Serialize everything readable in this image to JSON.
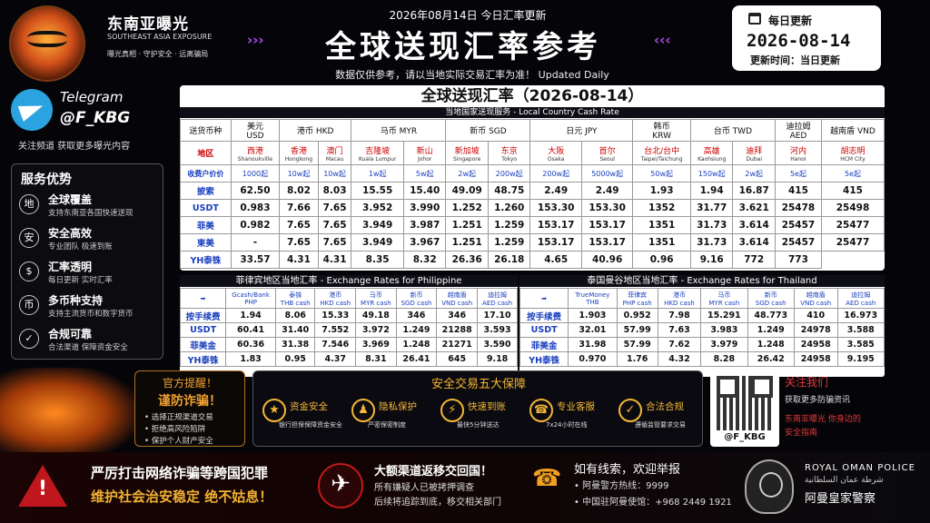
{
  "brand": {
    "name": "东南亚曝光",
    "en": "SOUTHEAST ASIA EXPOSURE",
    "slogan": "曝光真相 · 守护安全 · 远离骗局"
  },
  "header": {
    "top_date": "2026年08月14日  今日汇率更新",
    "title": "全球送现汇率参考",
    "subtitle": "数据仅供参考，请以当地实际交易汇率为准！ Updated Daily"
  },
  "date_box": {
    "heading": "每日更新",
    "date": "2026-08-14",
    "update_time": "更新时间：当日更新"
  },
  "telegram": {
    "label": "Telegram",
    "handle": "@F_KBG",
    "follow": "关注频道  获取更多曝光内容"
  },
  "services": {
    "heading": "服务优势",
    "items": [
      {
        "icon": "地",
        "title": "全球覆盖",
        "desc": "支持东南亚各国快速送现"
      },
      {
        "icon": "安",
        "title": "安全高效",
        "desc": "专业团队  极速到账"
      },
      {
        "icon": "$",
        "title": "汇率透明",
        "desc": "每日更新  实时汇率"
      },
      {
        "icon": "币",
        "title": "多币种支持",
        "desc": "支持主流货币和数字货币"
      },
      {
        "icon": "✓",
        "title": "合规可靠",
        "desc": "合法渠道  保障资金安全"
      }
    ]
  },
  "main_table": {
    "title": "全球送现汇率（2026-08-14）",
    "subtitle": "当地国家送现服务 - Local Country Cash Rate",
    "corner": "送货币种",
    "currencies": [
      {
        "label": "美元\nUSD",
        "span": 1
      },
      {
        "label": "港币  HKD",
        "span": 2
      },
      {
        "label": "马币  MYR",
        "span": 2
      },
      {
        "label": "新币  SGD",
        "span": 2
      },
      {
        "label": "日元  JPY",
        "span": 2
      },
      {
        "label": "韩币\nKRW",
        "span": 1
      },
      {
        "label": "台币  TWD",
        "span": 2
      },
      {
        "label": "迪拉姆\nAED",
        "span": 1
      },
      {
        "label": "越南盾  VND",
        "span": 2
      }
    ],
    "region_label": "地区",
    "locations": [
      {
        "cn": "西港",
        "en": "Shanoukville"
      },
      {
        "cn": "香港",
        "en": "Hongkong"
      },
      {
        "cn": "澳门",
        "en": "Macau"
      },
      {
        "cn": "吉隆坡",
        "en": "Kuala Lumpur"
      },
      {
        "cn": "新山",
        "en": "Johor"
      },
      {
        "cn": "新加坡",
        "en": "Singapore"
      },
      {
        "cn": "东京",
        "en": "Tokyo"
      },
      {
        "cn": "大阪",
        "en": "Osaka"
      },
      {
        "cn": "首尔",
        "en": "Seoul"
      },
      {
        "cn": "台北/台中",
        "en": "Taipei/Taichung"
      },
      {
        "cn": "高雄",
        "en": "Kaohsiung"
      },
      {
        "cn": "迪拜",
        "en": "Dubai"
      },
      {
        "cn": "河内",
        "en": "Hanoi"
      },
      {
        "cn": "胡志明",
        "en": "HCM City"
      }
    ],
    "fee_label": "收费户价价",
    "fees": [
      "1000起",
      "10w起",
      "10w起",
      "1w起",
      "5w起",
      "2w起",
      "200w起",
      "200w起",
      "5000w起",
      "50w起",
      "150w起",
      "2w起",
      "5e起",
      "5e起"
    ],
    "rows": [
      {
        "label": "披索",
        "values": [
          "62.50",
          "8.02",
          "8.03",
          "15.55",
          "15.40",
          "49.09",
          "48.75",
          "2.49",
          "2.49",
          "1.93",
          "1.94",
          "16.87",
          "415",
          "415"
        ]
      },
      {
        "label": "USDT",
        "values": [
          "0.983",
          "7.66",
          "7.65",
          "3.952",
          "3.990",
          "1.252",
          "1.260",
          "153.30",
          "153.30",
          "1352",
          "31.77",
          "3.621",
          "25478",
          "25498"
        ]
      },
      {
        "label": "菲美",
        "values": [
          "0.982",
          "7.65",
          "7.65",
          "3.949",
          "3.987",
          "1.251",
          "1.259",
          "153.17",
          "153.17",
          "1351",
          "31.73",
          "3.614",
          "25457",
          "25477"
        ]
      },
      {
        "label": "柬美",
        "values": [
          "-",
          "7.65",
          "7.65",
          "3.949",
          "3.967",
          "1.251",
          "1.259",
          "153.17",
          "153.17",
          "1351",
          "31.73",
          "3.614",
          "25457",
          "25477"
        ]
      },
      {
        "label": "YH泰铢",
        "values": [
          "33.57",
          "4.31",
          "4.31",
          "8.35",
          "8.32",
          "26.36",
          "26.18",
          "4.65",
          "40.96",
          "0.96",
          "9.16",
          "772",
          "773"
        ]
      }
    ]
  },
  "philippine": {
    "title": "菲律宾地区当地汇率 - Exchange Rates for Philippine",
    "corner": "➡",
    "headers": [
      "Gcash/Bank\nPHP",
      "泰铢\nTHB cash",
      "港币\nHKD cash",
      "马币\nMYR cash",
      "新币\nSGD cash",
      "越南盾\nVND cash",
      "迪拉姆\nAED cash"
    ],
    "rows": [
      {
        "label": "按手续费",
        "values": [
          "1.94",
          "8.06",
          "15.33",
          "49.18",
          "346",
          "346",
          "17.10"
        ]
      },
      {
        "label": "USDT",
        "values": [
          "60.41",
          "31.40",
          "7.552",
          "3.972",
          "1.249",
          "21288",
          "3.593"
        ]
      },
      {
        "label": "菲美金",
        "values": [
          "60.36",
          "31.38",
          "7.546",
          "3.969",
          "1.248",
          "21271",
          "3.590"
        ]
      },
      {
        "label": "YH泰铢",
        "values": [
          "1.83",
          "0.95",
          "4.37",
          "8.31",
          "26.41",
          "645",
          "9.18"
        ]
      }
    ]
  },
  "thailand": {
    "title": "泰国曼谷地区当地汇率 - Exchange Rates for Thailand",
    "corner": "➡",
    "headers": [
      "TrueMoney\nTHB",
      "菲律宾\nPHP cash",
      "港币\nHKD cash",
      "马币\nMYR cash",
      "新币\nSGD cash",
      "越南盾\nVND cash",
      "迪拉姆\nAED cash"
    ],
    "rows": [
      {
        "label": "按手续费",
        "values": [
          "1.903",
          "0.952",
          "7.98",
          "15.291",
          "48.773",
          "410",
          "16.973"
        ]
      },
      {
        "label": "USDT",
        "values": [
          "32.01",
          "57.99",
          "7.63",
          "3.983",
          "1.249",
          "24978",
          "3.588"
        ]
      },
      {
        "label": "菲美金",
        "values": [
          "31.98",
          "57.99",
          "7.62",
          "3.979",
          "1.248",
          "24958",
          "3.585"
        ]
      },
      {
        "label": "YH泰铢",
        "values": [
          "0.970",
          "1.76",
          "4.32",
          "8.28",
          "26.42",
          "24958",
          "9.195"
        ]
      }
    ]
  },
  "warning": {
    "line1": "官方提醒！",
    "line2": "谨防诈骗！",
    "items": [
      "• 选择正规渠道交易",
      "• 拒绝高风险陷阱",
      "• 保护个人财产安全"
    ]
  },
  "safety": {
    "title": "安全交易五大保障",
    "items": [
      {
        "icon": "★",
        "title": "资金安全",
        "desc": "银行担保保障资金安全"
      },
      {
        "icon": "♟",
        "title": "隐私保护",
        "desc": "严密保密制度"
      },
      {
        "icon": "⚡",
        "title": "快速到账",
        "desc": "最快5分钟送达"
      },
      {
        "icon": "☎",
        "title": "专业客服",
        "desc": "7x24小时在线"
      },
      {
        "icon": "✓",
        "title": "合法合规",
        "desc": "遵循监管要求交易"
      }
    ]
  },
  "qr": {
    "label": "@F_KBG"
  },
  "follow": {
    "title": "关注我们",
    "desc": "获取更多防骗资讯",
    "tag1": "东南亚曝光 你身边的",
    "tag2": "安全指南"
  },
  "bottom": {
    "crime1": "严厉打击网络诈骗等跨国犯罪",
    "crime2": "维护社会治安稳定  绝不姑息！",
    "return1": "大额渠道返移交回国！",
    "return2": "所有嫌疑人已被拷押调查",
    "return3": "后续将追踪到底，移交相关部门",
    "report1": "如有线索，欢迎举报",
    "report2": "• 阿曼警方热线：9999",
    "report3": "• 中国驻阿曼使馆：+968 2449 1921",
    "police_en": "ROYAL OMAN POLICE",
    "police_ar": "شرطة عمان السلطانية",
    "police_cn": "阿曼皇家警察"
  },
  "colors": {
    "accent_purple": "#b24cf0",
    "gold": "#f5b635",
    "red": "#c0161e",
    "blue_label": "#1a3fbf"
  }
}
